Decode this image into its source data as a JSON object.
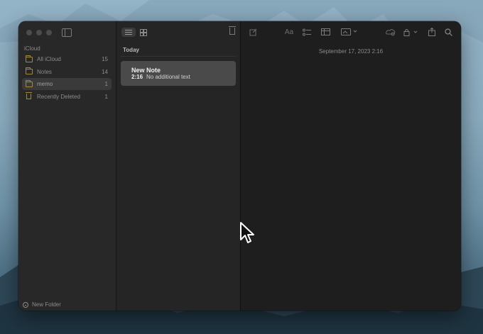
{
  "sidebar": {
    "section_label": "iCloud",
    "folders": [
      {
        "name": "All iCloud",
        "count": "15",
        "icon": "folder-icon"
      },
      {
        "name": "Notes",
        "count": "14",
        "icon": "folder-icon"
      },
      {
        "name": "memo",
        "count": "1",
        "icon": "folder-icon",
        "selected": true
      },
      {
        "name": "Recently Deleted",
        "count": "1",
        "icon": "trash-icon"
      }
    ],
    "new_folder_label": "New Folder"
  },
  "notelist": {
    "group_heading": "Today",
    "notes": [
      {
        "title": "New Note",
        "time": "2:16",
        "preview": "No additional text"
      }
    ]
  },
  "editor": {
    "date_line": "September 17, 2023 2:16",
    "format_label": "Aa"
  },
  "colors": {
    "accent_folder": "#a08a40",
    "window_bg": "#1e1e1e",
    "sidebar_bg": "#282828",
    "selected_card": "#4a4a4a"
  }
}
